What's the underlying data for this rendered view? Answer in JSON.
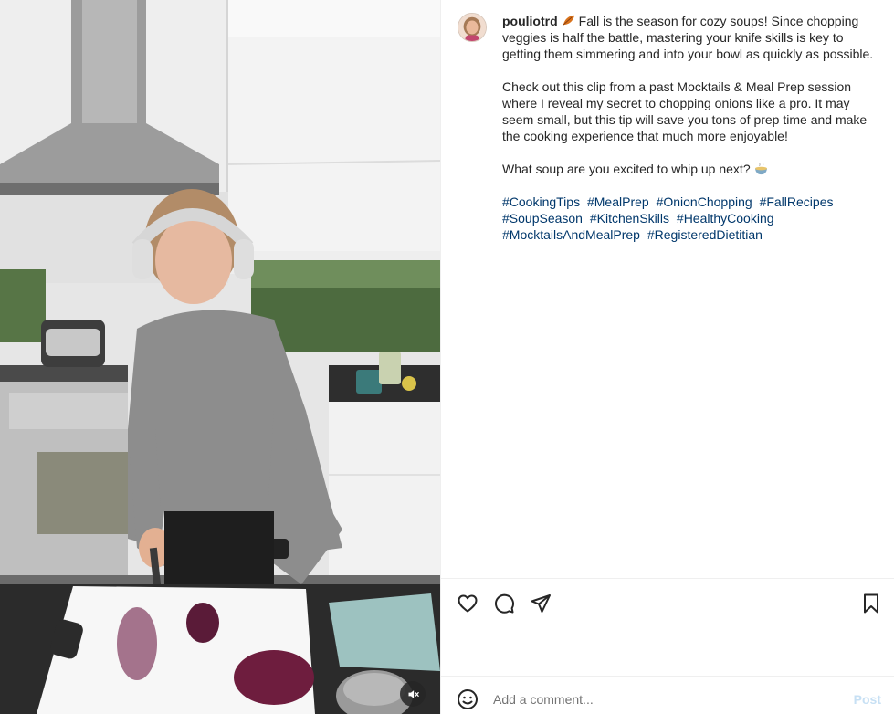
{
  "post": {
    "username": "pouliotrd",
    "caption_line1": "Fall is the season for cozy soups! Since chopping veggies is half the battle, mastering your knife skills is key to getting them simmering and into your bowl as quickly as possible.",
    "caption_para2": "Check out this clip from a past Mocktails & Meal Prep session where I reveal my secret to chopping onions like a pro. It may seem small, but this tip will save you tons of prep time and make the cooking experience that much more enjoyable!",
    "caption_para3": "What soup are you excited to whip up next?",
    "hashtags": [
      "#CookingTips",
      "#MealPrep",
      "#OnionChopping",
      "#FallRecipes",
      "#SoupSeason",
      "#KitchenSkills",
      "#HealthyCooking",
      "#MocktailsAndMealPrep",
      "#RegisteredDietitian"
    ],
    "leaf_emoji_icon": "fallen-leaf-icon",
    "soup_emoji_icon": "soup-bowl-icon"
  },
  "actions": {
    "like_icon": "heart-icon",
    "comment_icon": "comment-icon",
    "share_icon": "paper-plane-icon",
    "save_icon": "bookmark-icon"
  },
  "comment": {
    "placeholder": "Add a comment...",
    "post_label": "Post",
    "emoji_icon": "smiley-icon"
  },
  "video": {
    "mute_icon": "speaker-muted-icon"
  },
  "colors": {
    "hashtag": "#00376b",
    "text": "#262626",
    "post_disabled": "#c7e0f4",
    "divider": "#efefef"
  }
}
